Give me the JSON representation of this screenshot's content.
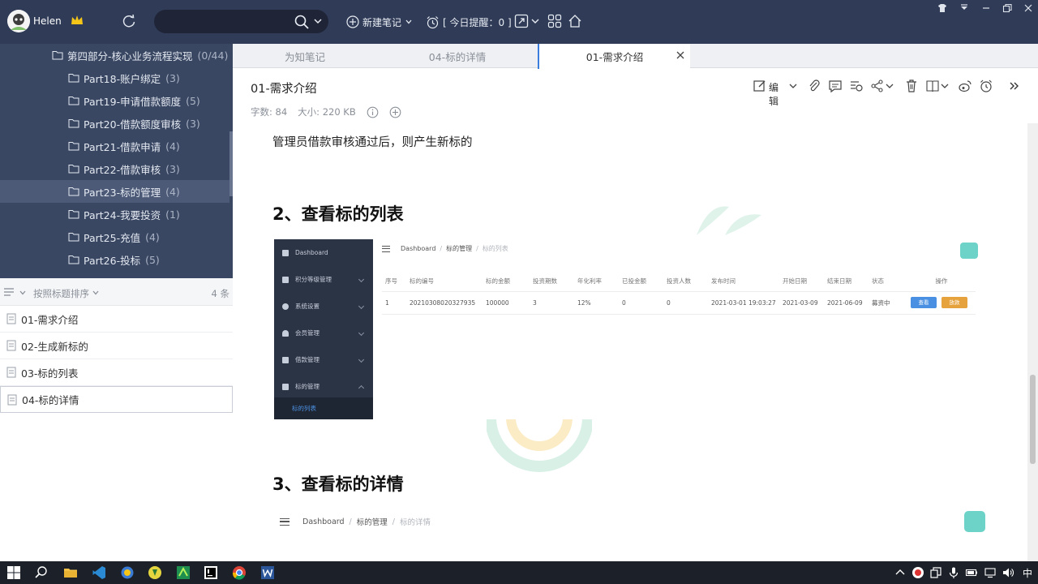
{
  "topbar": {
    "username": "Helen",
    "new_note": "新建笔记",
    "reminder": "[ 今日提醒：0 ]"
  },
  "tree": {
    "parent": {
      "label": "第四部分-核心业务流程实现",
      "count": "(0/44)"
    },
    "items": [
      {
        "label": "Part18-账户绑定",
        "count": "(3)"
      },
      {
        "label": "Part19-申请借款额度",
        "count": "(5)"
      },
      {
        "label": "Part20-借款额度审核",
        "count": "(3)"
      },
      {
        "label": "Part21-借款申请",
        "count": "(4)"
      },
      {
        "label": "Part22-借款审核",
        "count": "(3)"
      },
      {
        "label": "Part23-标的管理",
        "count": "(4)"
      },
      {
        "label": "Part24-我要投资",
        "count": "(1)"
      },
      {
        "label": "Part25-充值",
        "count": "(4)"
      },
      {
        "label": "Part26-投标",
        "count": "(5)"
      }
    ]
  },
  "sortbar": {
    "label": "按照标题排序",
    "count": "4 条"
  },
  "notes": [
    "01-需求介绍",
    "02-生成新标的",
    "03-标的列表",
    "04-标的详情"
  ],
  "tabs": [
    "为知笔记",
    "04-标的详情",
    "01-需求介绍"
  ],
  "note": {
    "title": "01-需求介绍",
    "word_count": "字数: 84",
    "size": "大小: 220 KB",
    "edit_label": "编辑"
  },
  "content": {
    "para1": "管理员借款审核通过后，则产生新标的",
    "h2_list": "2、查看标的列表",
    "h2_detail": "3、查看标的详情"
  },
  "shot1": {
    "menu": [
      "Dashboard",
      "积分等级管理",
      "系统设置",
      "会员管理",
      "借款管理",
      "标的管理",
      "标的列表"
    ],
    "crumb": [
      "Dashboard",
      "标的管理",
      "标的列表"
    ],
    "headers": [
      "序号",
      "标的编号",
      "标的金额",
      "投资期数",
      "年化利率",
      "已投金额",
      "投资人数",
      "发布时间",
      "开始日期",
      "结束日期",
      "状态",
      "操作"
    ],
    "row": [
      "1",
      "20210308020327935",
      "100000",
      "3",
      "12%",
      "0",
      "0",
      "2021-03-01 19:03:27",
      "2021-03-09",
      "2021-06-09",
      "募资中"
    ],
    "btn_view": "查看",
    "btn_settle": "放款"
  },
  "shot2": {
    "crumb": [
      "Dashboard",
      "标的管理",
      "标的详情"
    ]
  },
  "taskbar": {
    "ime": "中"
  }
}
